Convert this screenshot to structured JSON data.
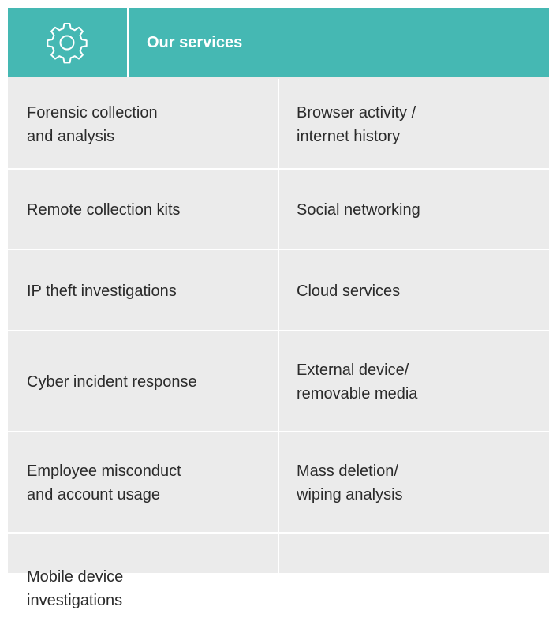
{
  "header": {
    "icon": "gear-icon",
    "title": "Our services",
    "accent_color": "#45b8b3"
  },
  "services": {
    "rows": [
      {
        "left": "Forensic collection\nand analysis",
        "right": "Browser activity /\ninternet history"
      },
      {
        "left": "Remote collection kits",
        "right": "Social networking"
      },
      {
        "left": "IP theft investigations",
        "right": "Cloud services"
      },
      {
        "left": "Cyber incident response",
        "right": "External device/\nremovable media"
      },
      {
        "left": "Employee misconduct\nand account usage",
        "right": "Mass deletion/\nwiping analysis"
      },
      {
        "left": "Mobile device\ninvestigations",
        "right": ""
      }
    ]
  }
}
